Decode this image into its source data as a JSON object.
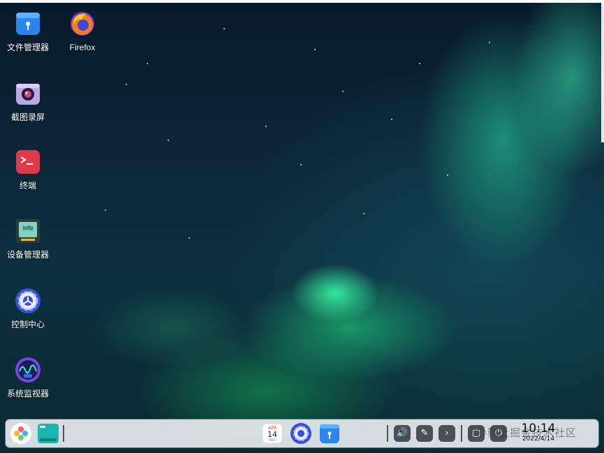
{
  "desktop": {
    "icons": [
      {
        "label": "文件管理器",
        "icon": "file-manager-icon"
      },
      {
        "label": "Firefox",
        "icon": "firefox-icon"
      },
      {
        "label": "截图录屏",
        "icon": "screen-capture-icon"
      },
      {
        "label": "终端",
        "icon": "terminal-icon"
      },
      {
        "label": "设备管理器",
        "icon": "device-manager-icon"
      },
      {
        "label": "控制中心",
        "icon": "control-center-icon"
      },
      {
        "label": "系统监视器",
        "icon": "system-monitor-icon"
      }
    ],
    "device_manager_glyph_text": "info"
  },
  "dock": {
    "launcher_icon": "launcher-icon",
    "multitask_icon": "multitask-view-icon",
    "calendar": {
      "month": "APR",
      "day": "14",
      "weekday": "THU"
    },
    "apps": [
      "calendar-icon",
      "control-center-icon",
      "file-manager-icon"
    ],
    "tray": [
      "volume-icon",
      "pen-icon",
      "chevron-right-icon",
      "screen-record-icon",
      "power-icon"
    ],
    "clock": {
      "time": "10:14",
      "date": "2022/4/14"
    },
    "watermark": "@稀土掘金技术社区"
  },
  "colors": {
    "dock_bg": "#e8ebee",
    "accent_blue": "#2b8cf0",
    "terminal_red": "#e03a4a"
  }
}
